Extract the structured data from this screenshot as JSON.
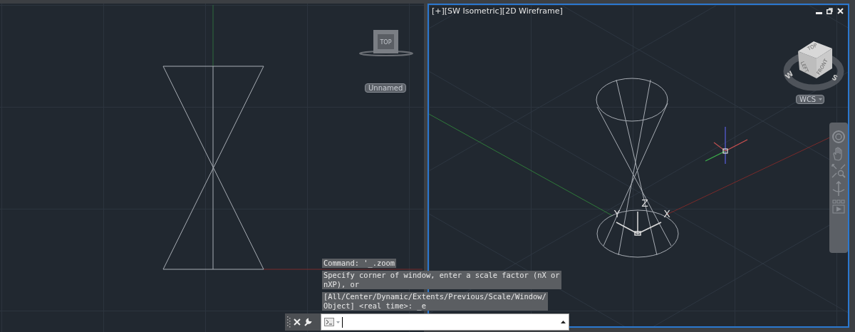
{
  "left_viewport": {
    "active": false,
    "viewcube": {
      "faces": [
        "TOP"
      ]
    },
    "ucs_menu": "Unnamed"
  },
  "right_viewport": {
    "active": true,
    "label": "[+][SW Isometric][2D Wireframe]",
    "viewcube": {
      "faces": [
        "TOP",
        "LEFT",
        "FRONT"
      ],
      "compass": [
        "W",
        "S"
      ]
    },
    "ucs_menu": "WCS",
    "axes": [
      "Z",
      "Y",
      "X"
    ]
  },
  "command_history": [
    {
      "lines": [
        "Command: '_.zoom"
      ]
    },
    {
      "lines": [
        "Specify corner of window, enter a scale factor (nX or",
        "nXP), or"
      ]
    },
    {
      "lines": [
        "[All/Center/Dynamic/Extents/Previous/Scale/Window/",
        "Object] <real time>: _e"
      ]
    }
  ]
}
